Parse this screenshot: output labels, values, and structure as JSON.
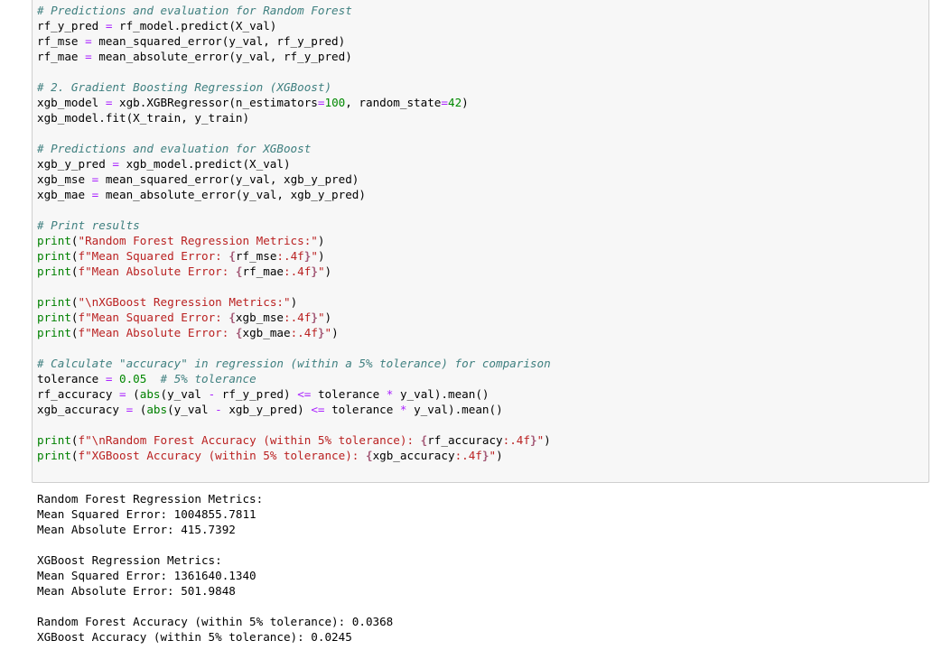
{
  "code_cell": {
    "lines": [
      [
        {
          "t": "# Predictions and evaluation for Random Forest",
          "c": "cm"
        }
      ],
      [
        {
          "t": "rf_y_pred ",
          "c": ""
        },
        {
          "t": "=",
          "c": "op"
        },
        {
          "t": " rf_model.predict(X_val)",
          "c": ""
        }
      ],
      [
        {
          "t": "rf_mse ",
          "c": ""
        },
        {
          "t": "=",
          "c": "op"
        },
        {
          "t": " mean_squared_error(y_val, rf_y_pred)",
          "c": ""
        }
      ],
      [
        {
          "t": "rf_mae ",
          "c": ""
        },
        {
          "t": "=",
          "c": "op"
        },
        {
          "t": " mean_absolute_error(y_val, rf_y_pred)",
          "c": ""
        }
      ],
      [],
      [
        {
          "t": "# 2. Gradient Boosting Regression (XGBoost)",
          "c": "cm"
        }
      ],
      [
        {
          "t": "xgb_model ",
          "c": ""
        },
        {
          "t": "=",
          "c": "op"
        },
        {
          "t": " xgb.XGBRegressor(n_estimators",
          "c": ""
        },
        {
          "t": "=",
          "c": "op"
        },
        {
          "t": "100",
          "c": "nm"
        },
        {
          "t": ", random_state",
          "c": ""
        },
        {
          "t": "=",
          "c": "op"
        },
        {
          "t": "42",
          "c": "nm"
        },
        {
          "t": ")",
          "c": ""
        }
      ],
      [
        {
          "t": "xgb_model.fit(X_train, y_train)",
          "c": ""
        }
      ],
      [],
      [
        {
          "t": "# Predictions and evaluation for XGBoost",
          "c": "cm"
        }
      ],
      [
        {
          "t": "xgb_y_pred ",
          "c": ""
        },
        {
          "t": "=",
          "c": "op"
        },
        {
          "t": " xgb_model.predict(X_val)",
          "c": ""
        }
      ],
      [
        {
          "t": "xgb_mse ",
          "c": ""
        },
        {
          "t": "=",
          "c": "op"
        },
        {
          "t": " mean_squared_error(y_val, xgb_y_pred)",
          "c": ""
        }
      ],
      [
        {
          "t": "xgb_mae ",
          "c": ""
        },
        {
          "t": "=",
          "c": "op"
        },
        {
          "t": " mean_absolute_error(y_val, xgb_y_pred)",
          "c": ""
        }
      ],
      [],
      [
        {
          "t": "# Print results",
          "c": "cm"
        }
      ],
      [
        {
          "t": "print",
          "c": "bi"
        },
        {
          "t": "(",
          "c": ""
        },
        {
          "t": "\"Random Forest Regression Metrics:\"",
          "c": "st"
        },
        {
          "t": ")",
          "c": ""
        }
      ],
      [
        {
          "t": "print",
          "c": "bi"
        },
        {
          "t": "(",
          "c": ""
        },
        {
          "t": "f\"Mean Squared Error: ",
          "c": "st"
        },
        {
          "t": "{",
          "c": "si"
        },
        {
          "t": "rf_mse",
          "c": ""
        },
        {
          "t": ":.4f",
          "c": "st"
        },
        {
          "t": "}",
          "c": "si"
        },
        {
          "t": "\"",
          "c": "st"
        },
        {
          "t": ")",
          "c": ""
        }
      ],
      [
        {
          "t": "print",
          "c": "bi"
        },
        {
          "t": "(",
          "c": ""
        },
        {
          "t": "f\"Mean Absolute Error: ",
          "c": "st"
        },
        {
          "t": "{",
          "c": "si"
        },
        {
          "t": "rf_mae",
          "c": ""
        },
        {
          "t": ":.4f",
          "c": "st"
        },
        {
          "t": "}",
          "c": "si"
        },
        {
          "t": "\"",
          "c": "st"
        },
        {
          "t": ")",
          "c": ""
        }
      ],
      [],
      [
        {
          "t": "print",
          "c": "bi"
        },
        {
          "t": "(",
          "c": ""
        },
        {
          "t": "\"\\nXGBoost Regression Metrics:\"",
          "c": "st"
        },
        {
          "t": ")",
          "c": ""
        }
      ],
      [
        {
          "t": "print",
          "c": "bi"
        },
        {
          "t": "(",
          "c": ""
        },
        {
          "t": "f\"Mean Squared Error: ",
          "c": "st"
        },
        {
          "t": "{",
          "c": "si"
        },
        {
          "t": "xgb_mse",
          "c": ""
        },
        {
          "t": ":.4f",
          "c": "st"
        },
        {
          "t": "}",
          "c": "si"
        },
        {
          "t": "\"",
          "c": "st"
        },
        {
          "t": ")",
          "c": ""
        }
      ],
      [
        {
          "t": "print",
          "c": "bi"
        },
        {
          "t": "(",
          "c": ""
        },
        {
          "t": "f\"Mean Absolute Error: ",
          "c": "st"
        },
        {
          "t": "{",
          "c": "si"
        },
        {
          "t": "xgb_mae",
          "c": ""
        },
        {
          "t": ":.4f",
          "c": "st"
        },
        {
          "t": "}",
          "c": "si"
        },
        {
          "t": "\"",
          "c": "st"
        },
        {
          "t": ")",
          "c": ""
        }
      ],
      [],
      [
        {
          "t": "# Calculate \"accuracy\" in regression (within a 5% tolerance) for comparison",
          "c": "cm"
        }
      ],
      [
        {
          "t": "tolerance ",
          "c": ""
        },
        {
          "t": "=",
          "c": "op"
        },
        {
          "t": " ",
          "c": ""
        },
        {
          "t": "0.05",
          "c": "nm"
        },
        {
          "t": "  ",
          "c": ""
        },
        {
          "t": "# 5% tolerance",
          "c": "cm"
        }
      ],
      [
        {
          "t": "rf_accuracy ",
          "c": ""
        },
        {
          "t": "=",
          "c": "op"
        },
        {
          "t": " (",
          "c": ""
        },
        {
          "t": "abs",
          "c": "bi"
        },
        {
          "t": "(y_val ",
          "c": ""
        },
        {
          "t": "-",
          "c": "op"
        },
        {
          "t": " rf_y_pred) ",
          "c": ""
        },
        {
          "t": "<=",
          "c": "op"
        },
        {
          "t": " tolerance ",
          "c": ""
        },
        {
          "t": "*",
          "c": "op"
        },
        {
          "t": " y_val).mean()",
          "c": ""
        }
      ],
      [
        {
          "t": "xgb_accuracy ",
          "c": ""
        },
        {
          "t": "=",
          "c": "op"
        },
        {
          "t": " (",
          "c": ""
        },
        {
          "t": "abs",
          "c": "bi"
        },
        {
          "t": "(y_val ",
          "c": ""
        },
        {
          "t": "-",
          "c": "op"
        },
        {
          "t": " xgb_y_pred) ",
          "c": ""
        },
        {
          "t": "<=",
          "c": "op"
        },
        {
          "t": " tolerance ",
          "c": ""
        },
        {
          "t": "*",
          "c": "op"
        },
        {
          "t": " y_val).mean()",
          "c": ""
        }
      ],
      [],
      [
        {
          "t": "print",
          "c": "bi"
        },
        {
          "t": "(",
          "c": ""
        },
        {
          "t": "f\"\\nRandom Forest Accuracy (within 5% tolerance): ",
          "c": "st"
        },
        {
          "t": "{",
          "c": "si"
        },
        {
          "t": "rf_accuracy",
          "c": ""
        },
        {
          "t": ":.4f",
          "c": "st"
        },
        {
          "t": "}",
          "c": "si"
        },
        {
          "t": "\"",
          "c": "st"
        },
        {
          "t": ")",
          "c": ""
        }
      ],
      [
        {
          "t": "print",
          "c": "bi"
        },
        {
          "t": "(",
          "c": ""
        },
        {
          "t": "f\"XGBoost Accuracy (within 5% tolerance): ",
          "c": "st"
        },
        {
          "t": "{",
          "c": "si"
        },
        {
          "t": "xgb_accuracy",
          "c": ""
        },
        {
          "t": ":.4f",
          "c": "st"
        },
        {
          "t": "}",
          "c": "si"
        },
        {
          "t": "\"",
          "c": "st"
        },
        {
          "t": ")",
          "c": ""
        }
      ]
    ]
  },
  "output_cell": {
    "lines": [
      "Random Forest Regression Metrics:",
      "Mean Squared Error: 1004855.7811",
      "Mean Absolute Error: 415.7392",
      "",
      "XGBoost Regression Metrics:",
      "Mean Squared Error: 1361640.1340",
      "Mean Absolute Error: 501.9848",
      "",
      "Random Forest Accuracy (within 5% tolerance): 0.0368",
      "XGBoost Accuracy (within 5% tolerance): 0.0245"
    ]
  },
  "colors": {
    "cell_background": "#f7f7f7",
    "cell_border": "#cfcfcf",
    "comment": "#408080",
    "string": "#ba2121",
    "number": "#008800",
    "operator": "#aa22ff",
    "builtin": "#008000"
  }
}
